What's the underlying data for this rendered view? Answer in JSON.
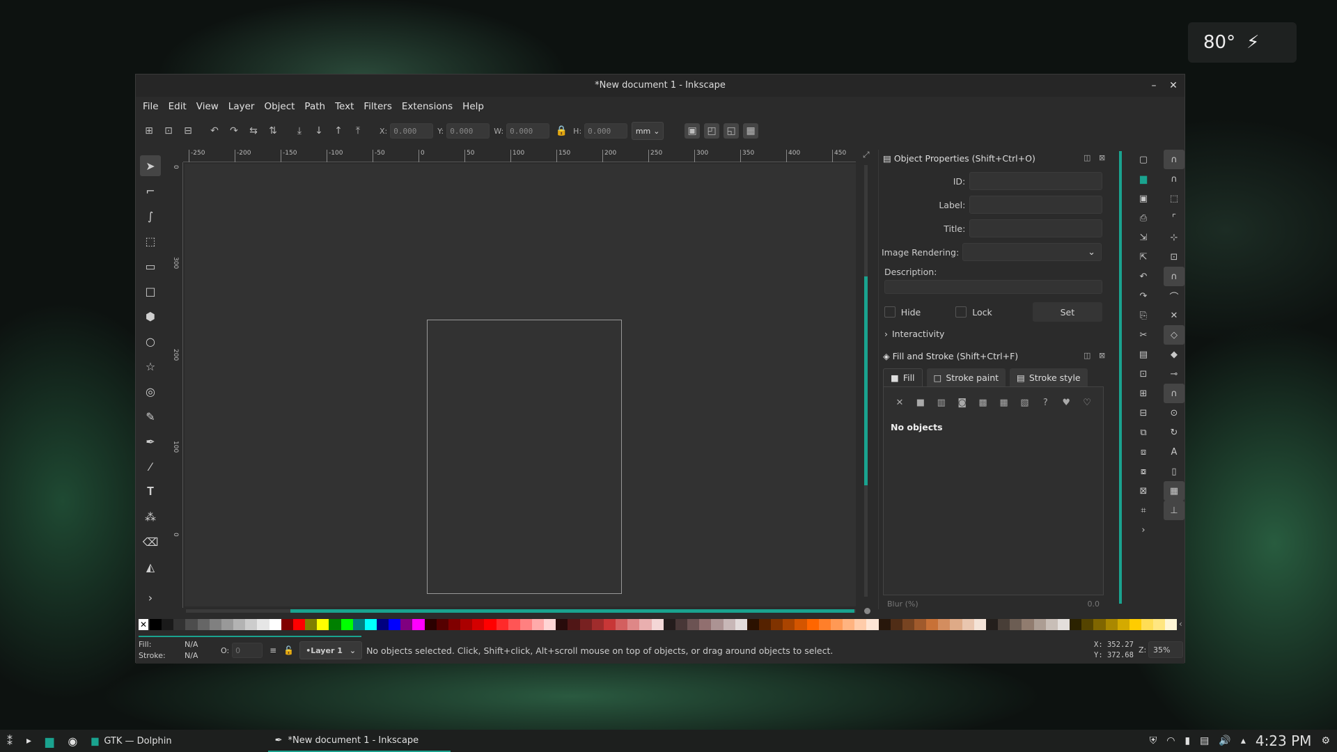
{
  "weather": {
    "temp": "80°",
    "icon": "weather-lightning-icon"
  },
  "window": {
    "title": "*New document 1 - Inkscape",
    "minimize": "–",
    "close": "✕"
  },
  "menu": [
    "File",
    "Edit",
    "View",
    "Layer",
    "Object",
    "Path",
    "Text",
    "Filters",
    "Extensions",
    "Help"
  ],
  "toolbar": {
    "x_label": "X:",
    "x_value": "0.000",
    "y_label": "Y:",
    "y_value": "0.000",
    "w_label": "W:",
    "w_value": "0.000",
    "h_label": "H:",
    "h_value": "0.000",
    "unit": "mm"
  },
  "ruler": {
    "h_ticks": [
      "-250",
      "-200",
      "-150",
      "-100",
      "-50",
      "0",
      "50",
      "100",
      "150",
      "200",
      "250",
      "300",
      "350",
      "400",
      "450"
    ],
    "v_ticks": [
      "0",
      "300",
      "200",
      "100",
      "0"
    ]
  },
  "object_properties": {
    "title": "Object Properties (Shift+Ctrl+O)",
    "id_label": "ID:",
    "label_label": "Label:",
    "title_label": "Title:",
    "image_rendering_label": "Image Rendering:",
    "description_label": "Description:",
    "hide_label": "Hide",
    "lock_label": "Lock",
    "set_label": "Set",
    "interactivity_label": "Interactivity"
  },
  "fill_stroke": {
    "title": "Fill and Stroke (Shift+Ctrl+F)",
    "tabs": [
      "Fill",
      "Stroke paint",
      "Stroke style"
    ],
    "message": "No objects",
    "blur_label": "Blur (%)",
    "blur_value": "0.0"
  },
  "status": {
    "fill_label": "Fill:",
    "fill_value": "N/A",
    "stroke_label": "Stroke:",
    "stroke_value": "N/A",
    "opacity_label": "O:",
    "opacity_value": "0",
    "layer": "•Layer 1",
    "message": "No objects selected. Click, Shift+click, Alt+scroll mouse on top of objects, or drag around objects to select.",
    "x_label": "X:",
    "x_value": "352.27",
    "y_label": "Y:",
    "y_value": "372.68",
    "zoom_label": "Z:",
    "zoom_value": "35%"
  },
  "palette": [
    "#000000",
    "#1a1a1a",
    "#333333",
    "#4d4d4d",
    "#666666",
    "#808080",
    "#999999",
    "#b3b3b3",
    "#cccccc",
    "#e6e6e6",
    "#ffffff",
    "#800000",
    "#ff0000",
    "#808000",
    "#ffff00",
    "#008000",
    "#00ff00",
    "#008080",
    "#00ffff",
    "#000080",
    "#0000ff",
    "#800080",
    "#ff00ff",
    "#2b0000",
    "#550000",
    "#800000",
    "#aa0000",
    "#d40000",
    "#ff0000",
    "#ff2a2a",
    "#ff5555",
    "#ff8080",
    "#ffaaaa",
    "#ffd5d5",
    "#280b0b",
    "#501616",
    "#782121",
    "#a02c2c",
    "#c83737",
    "#d35f5f",
    "#de8787",
    "#e9afaf",
    "#f4d7d7",
    "#241c1c",
    "#483737",
    "#6c5353",
    "#916f6f",
    "#ac9393",
    "#c8b7b7",
    "#e3dbdb",
    "#2b1100",
    "#552200",
    "#803300",
    "#aa4400",
    "#d45500",
    "#ff6600",
    "#ff7f2a",
    "#ff9955",
    "#ffb380",
    "#ffccaa",
    "#ffe6d5",
    "#28170b",
    "#502d16",
    "#784421",
    "#a05a2c",
    "#c87137",
    "#d38d5f",
    "#deaa87",
    "#e9c6af",
    "#f4e3d7",
    "#241f1c",
    "#483e37",
    "#6c5d53",
    "#917c6f",
    "#ac9d93",
    "#c8beb7",
    "#e3dedb",
    "#2b2200",
    "#554400",
    "#806600",
    "#aa8800",
    "#d4aa00",
    "#ffcc00",
    "#ffdd55",
    "#ffe680",
    "#fff6d5"
  ],
  "taskbar": {
    "dolphin": "GTK — Dolphin",
    "inkscape": "*New document 1 - Inkscape",
    "clock": "4:23 PM"
  }
}
